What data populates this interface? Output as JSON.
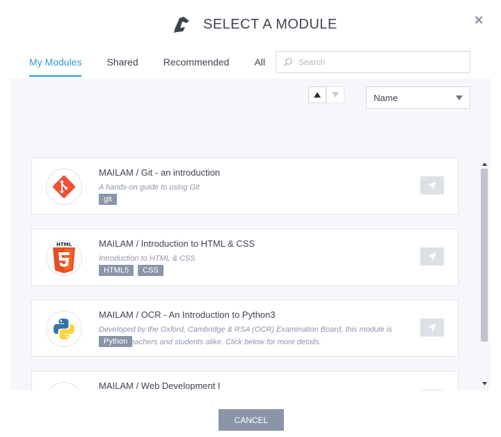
{
  "dialog": {
    "title": "SELECT A MODULE",
    "close_label": "×"
  },
  "tabs": [
    {
      "label": "My Modules",
      "active": true
    },
    {
      "label": "Shared",
      "active": false
    },
    {
      "label": "Recommended",
      "active": false
    },
    {
      "label": "All",
      "active": false
    }
  ],
  "search": {
    "placeholder": "Search",
    "value": ""
  },
  "sort": {
    "field": "Name",
    "direction": "ascending"
  },
  "modules": [
    {
      "title": "MAILAM / Git - an introduction",
      "description": "A hands-on guide to using Git",
      "tags": [
        "git"
      ],
      "logo": "git-logo"
    },
    {
      "title": "MAILAM / Introduction to HTML & CSS",
      "description": "Introduction to HTML & CSS",
      "tags": [
        "HTML5",
        "CSS"
      ],
      "logo": "html5-logo"
    },
    {
      "title": "MAILAM / OCR - An Introduction to Python3",
      "description": "Developed by the Oxford, Cambridge & RSA (OCR) Examination Board, this module is ideal for teachers and students alike. Click below for more details.",
      "tags": [
        "Python"
      ],
      "logo": "python-logo"
    },
    {
      "title": "MAILAM / Web Development I",
      "description": "",
      "tags": [],
      "logo": "webdev-logo"
    }
  ],
  "footer": {
    "cancel_label": "CANCEL"
  },
  "colors": {
    "accent": "#2d9ad8",
    "tag": "#8a95a8",
    "cancel_button": "#8a95a8",
    "git": "#f05033",
    "html5": "#e44d26"
  }
}
